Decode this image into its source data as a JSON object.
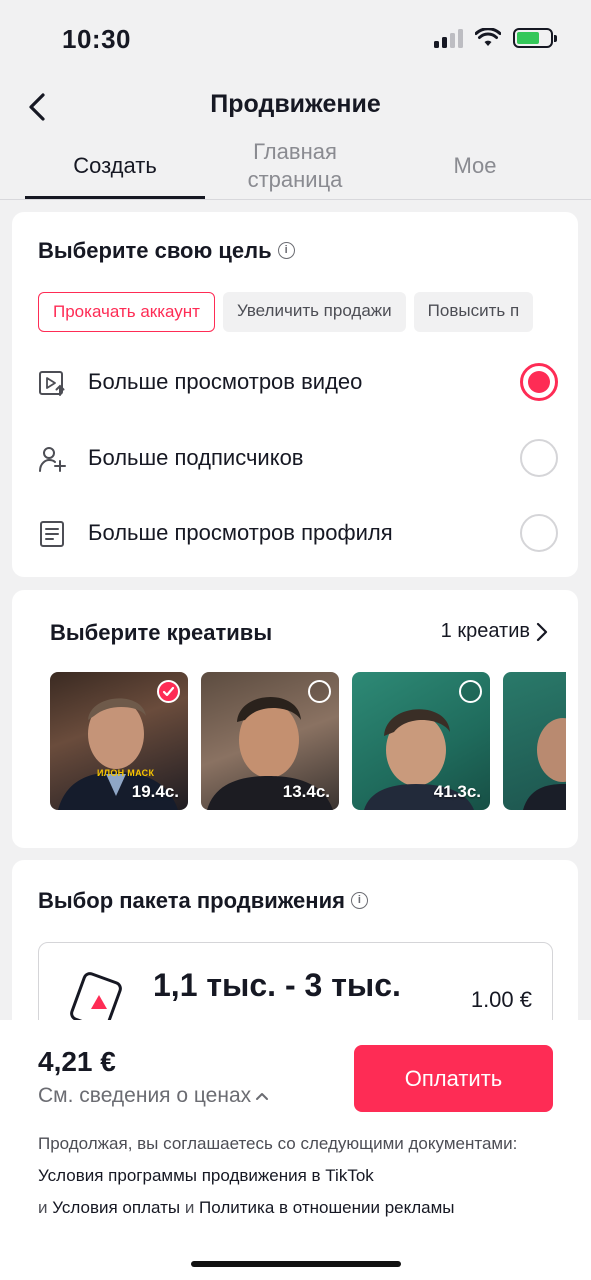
{
  "status_bar": {
    "time": "10:30",
    "signal_icon": "signal-icon",
    "wifi_icon": "wifi-icon",
    "battery_icon": "battery-charging-icon"
  },
  "header": {
    "title": "Продвижение",
    "back_icon": "chevron-left-icon"
  },
  "tabs": [
    {
      "label": "Создать",
      "active": true
    },
    {
      "label": "Главная\nстраница",
      "active": false
    },
    {
      "label": "Мое",
      "active": false
    }
  ],
  "goal_section": {
    "title": "Выберите свою цель",
    "chips": [
      {
        "label": "Прокачать аккаунт",
        "active": true
      },
      {
        "label": "Увеличить продажи",
        "active": false
      },
      {
        "label": "Повысить п",
        "active": false
      }
    ],
    "options": [
      {
        "icon": "video-views-icon",
        "label": "Больше просмотров видео",
        "selected": true
      },
      {
        "icon": "add-follower-icon",
        "label": "Больше подписчиков",
        "selected": false
      },
      {
        "icon": "profile-doc-icon",
        "label": "Больше просмотров профиля",
        "selected": false
      }
    ]
  },
  "creatives_section": {
    "title": "Выберите креативы",
    "link_label": "1 креатив",
    "thumbnails": [
      {
        "duration": "19.4с.",
        "selected": true,
        "overlay": "ИЛОН МАСК"
      },
      {
        "duration": "13.4с.",
        "selected": false
      },
      {
        "duration": "41.3с.",
        "selected": false
      },
      {
        "duration": "",
        "selected": false
      }
    ]
  },
  "package_section": {
    "title": "Выбор пакета продвижения",
    "package": {
      "range": "1,1 тыс. - 3 тыс.",
      "price": "1.00 €"
    }
  },
  "footer": {
    "total": "4,21 €",
    "price_details": "См. сведения о ценах",
    "pay_button": "Оплатить",
    "legal_prefix": "Продолжая, вы соглашаетесь со следующими документами: ",
    "legal_link1": "Условия программы продвижения в TikTok",
    "legal_and1": " и ",
    "legal_link2": "Условия оплаты",
    "legal_and2": " и ",
    "legal_link3": "Политика в отношении рекламы"
  },
  "colors": {
    "accent": "#fe2c55",
    "text": "#161823",
    "muted": "#8a8b91",
    "background": "#f1f1f2"
  }
}
